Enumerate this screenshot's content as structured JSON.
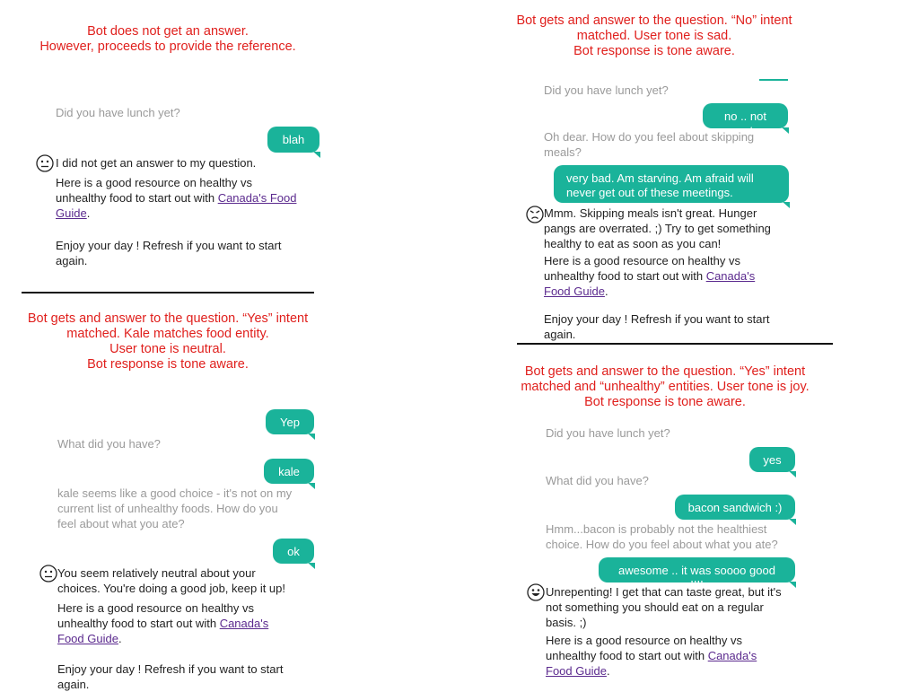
{
  "panel1": {
    "caption": [
      "Bot does not get an answer.",
      "However, proceeds to provide the reference."
    ],
    "q1": "Did you have lunch yet?",
    "u1": "blah",
    "b1": "I did not get an answer to my question.",
    "ref_pre": "Here is a good resource on healthy vs unhealthy food to start out with",
    "ref_link": "Canada's Food Guide",
    "ref_post": ".",
    "bye": "Enjoy your day ! Refresh if you want to start again.",
    "emoji": "neutral-face-icon"
  },
  "panel2": {
    "caption": [
      "Bot gets and answer to the question. “No” intent",
      "matched. User tone is sad.",
      "Bot response is tone aware."
    ],
    "q1": "Did you have lunch yet?",
    "u1": "no .. not yet",
    "q2": "Oh dear. How do you feel about skipping meals?",
    "u2": "very bad. Am starving. Am afraid will never get out of these meetings.",
    "b1": "Mmm. Skipping meals isn't great. Hunger pangs are overrated. ;) Try to get something healthy to eat as soon as you can!",
    "ref_pre": "Here is a good resource on healthy vs unhealthy food to start out with",
    "ref_link": "Canada's Food Guide",
    "ref_post": ".",
    "bye": "Enjoy your day ! Refresh if you want to start again.",
    "emoji": "sad-face-icon"
  },
  "panel3": {
    "caption": [
      "Bot gets and answer to the question. “Yes” intent",
      "matched. Kale matches food entity.",
      "User tone is neutral.",
      "Bot response is tone aware."
    ],
    "u1": "Yep",
    "q1": "What did you have?",
    "u2": "kale",
    "q2": "kale seems like a good choice - it's not on my current list of unhealthy foods. How do you feel about what you ate?",
    "u3": "ok",
    "b1": "You seem relatively neutral about your choices. You're doing a good job, keep it up!",
    "ref_pre": "Here is a good resource on healthy vs unhealthy food to start out with",
    "ref_link": "Canada's Food Guide",
    "ref_post": ".",
    "bye": "Enjoy your day ! Refresh if you want to start again.",
    "emoji": "neutral-face-icon"
  },
  "panel4": {
    "caption": [
      "Bot gets and answer to the question. “Yes” intent",
      "matched and “unhealthy” entities. User tone is joy.",
      "Bot response is tone aware."
    ],
    "q1": "Did you have lunch yet?",
    "u1": "yes",
    "q2": "What did you have?",
    "u2": "bacon sandwich :)",
    "q3": "Hmm...bacon is probably not the healthiest choice. How do you feel about what you ate?",
    "u3": "awesome .. it was soooo good !!!!",
    "b1": "Unrepenting! I get that can taste great, but it's not something you should eat on a regular basis. ;)",
    "ref_pre": "Here is a good resource on healthy vs unhealthy food to start out with",
    "ref_link": "Canada's Food Guide",
    "ref_post": ".",
    "emoji": "happy-face-icon"
  },
  "colors": {
    "caption": "#e0201d",
    "bubble": "#1ab39a",
    "link": "#5b2a8e",
    "muted": "#9a9a9a"
  }
}
